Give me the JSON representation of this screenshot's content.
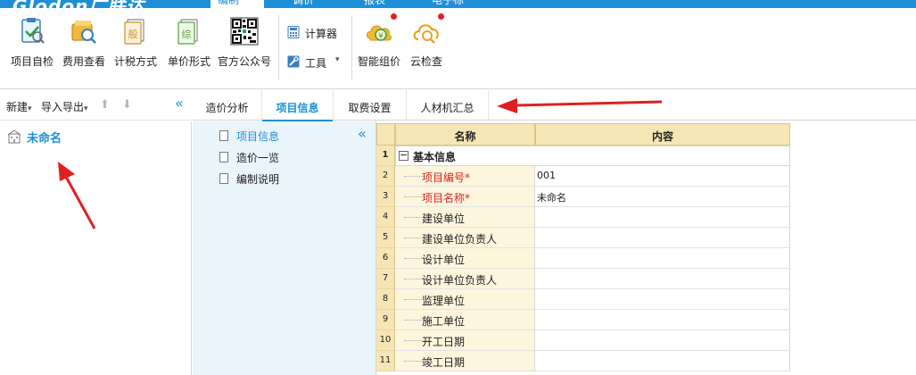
{
  "titlebar": {
    "logo": "Glodon广联达",
    "menus": [
      {
        "label": "编制",
        "active": true
      },
      {
        "label": "调价",
        "active": false
      },
      {
        "label": "报表",
        "active": false
      },
      {
        "label": "电子标",
        "active": false
      }
    ]
  },
  "ribbon": {
    "buttons": [
      {
        "label": "项目自检",
        "icon": "project-check-icon"
      },
      {
        "label": "费用查看",
        "icon": "fee-view-icon"
      },
      {
        "label": "计税方式",
        "icon": "tax-method-icon"
      },
      {
        "label": "单价形式",
        "icon": "unit-price-icon"
      },
      {
        "label": "官方公众号",
        "icon": "qr-code-icon"
      }
    ],
    "small_buttons": [
      {
        "label": "计算器",
        "icon": "calculator-icon"
      },
      {
        "label": "工具",
        "icon": "tools-icon",
        "dropdown": "▾"
      }
    ],
    "buttons2": [
      {
        "label": "智能组价",
        "icon": "smart-pricing-icon"
      },
      {
        "label": "云检查",
        "icon": "cloud-check-icon"
      }
    ]
  },
  "left_panel": {
    "new_label": "新建",
    "import_export_label": "导入导出",
    "dropdown_glyph": "▾",
    "up_glyph": "⬆",
    "down_glyph": "⬇",
    "collapse_glyph": "«",
    "tree_node": "未命名"
  },
  "tabs": [
    {
      "label": "造价分析",
      "active": false
    },
    {
      "label": "项目信息",
      "active": true
    },
    {
      "label": "取费设置",
      "active": false
    },
    {
      "label": "人材机汇总",
      "active": false
    }
  ],
  "nav": {
    "collapse_glyph": "«",
    "items": [
      {
        "label": "项目信息",
        "active": true
      },
      {
        "label": "造价一览",
        "active": false
      },
      {
        "label": "编制说明",
        "active": false
      }
    ]
  },
  "grid": {
    "headers": {
      "name": "名称",
      "content": "内容"
    },
    "group": {
      "num": "1",
      "toggle": "−",
      "label": "基本信息"
    },
    "rows": [
      {
        "num": "2",
        "name": "项目编号*",
        "value": "001",
        "required": true
      },
      {
        "num": "3",
        "name": "项目名称*",
        "value": "未命名",
        "required": true
      },
      {
        "num": "4",
        "name": "建设单位",
        "value": "",
        "required": false
      },
      {
        "num": "5",
        "name": "建设单位负责人",
        "value": "",
        "required": false
      },
      {
        "num": "6",
        "name": "设计单位",
        "value": "",
        "required": false
      },
      {
        "num": "7",
        "name": "设计单位负责人",
        "value": "",
        "required": false
      },
      {
        "num": "8",
        "name": "监理单位",
        "value": "",
        "required": false
      },
      {
        "num": "9",
        "name": "施工单位",
        "value": "",
        "required": false
      },
      {
        "num": "10",
        "name": "开工日期",
        "value": "",
        "required": false
      },
      {
        "num": "11",
        "name": "竣工日期",
        "value": "",
        "required": false
      }
    ]
  },
  "colors": {
    "accent": "#1e8fd6",
    "header_bg": "#f7e6b5",
    "required_text": "#d42424",
    "annotation_arrow": "#e02020"
  }
}
